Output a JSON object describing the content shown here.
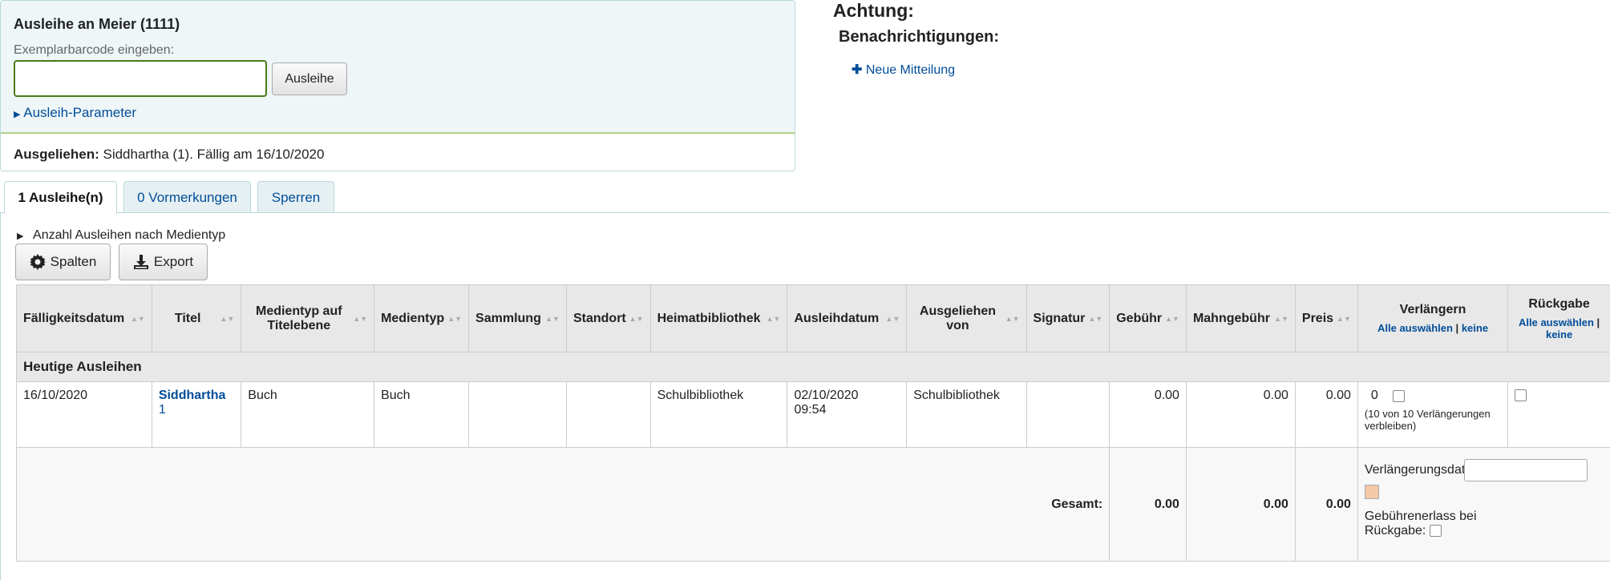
{
  "checkout": {
    "title": "Ausleihe an Meier (1111)",
    "barcode_label": "Exemplarbarcode eingeben:",
    "barcode_value": "",
    "submit_label": "Ausleihe",
    "params_label": "Ausleih-Parameter",
    "checked_out_label": "Ausgeliehen:",
    "checked_out_text": "Siddhartha (1). Fällig am 16/10/2020"
  },
  "notices": {
    "attention": "Achtung:",
    "notifications_title": "Benachrichtigungen:",
    "new_notice_label": "Neue Mitteilung"
  },
  "tabs": [
    {
      "label": "1 Ausleihe(n)",
      "active": true
    },
    {
      "label": "0 Vormerkungen",
      "active": false
    },
    {
      "label": "Sperren",
      "active": false
    }
  ],
  "toolbar": {
    "count_toggle_label": "Anzahl Ausleihen nach Medientyp",
    "columns_label": "Spalten",
    "export_label": "Export"
  },
  "table": {
    "headers": {
      "due_date": "Fälligkeitsdatum",
      "title": "Titel",
      "record_itemtype": "Medientyp auf Titelebene",
      "itemtype": "Medientyp",
      "collection": "Sammlung",
      "location": "Standort",
      "home_library": "Heimatbibliothek",
      "checkout_date": "Ausleihdatum",
      "checked_out_from": "Ausgeliehen von",
      "callnumber": "Signatur",
      "charge": "Gebühr",
      "fine": "Mahngebühr",
      "price": "Preis",
      "renew": "Verlängern",
      "return": "Rückgabe"
    },
    "select_all": "Alle auswählen",
    "separator": "|",
    "select_none": "keine",
    "group_label": "Heutige Ausleihen",
    "rows": [
      {
        "due_date": "16/10/2020",
        "title": "Siddhartha",
        "title_number": "1",
        "record_itemtype": "Buch",
        "itemtype": "Buch",
        "collection": "",
        "location": "",
        "home_library": "Schulbibliothek",
        "checkout_date": "02/10/2020",
        "checkout_time": "09:54",
        "checked_out_from": "Schulbibliothek",
        "callnumber": "",
        "charge": "0.00",
        "fine": "0.00",
        "price": "0.00",
        "renew_count": "0",
        "renew_note": "(10 von 10 Verlängerungen verbleiben)"
      }
    ],
    "totals": {
      "label": "Gesamt:",
      "charge": "0.00",
      "fine": "0.00",
      "price": "0.00"
    },
    "renewal_date_label": "Verlängerungsdatum:",
    "forgive_fines_label": "Gebührenerlass bei Rückgabe:"
  }
}
